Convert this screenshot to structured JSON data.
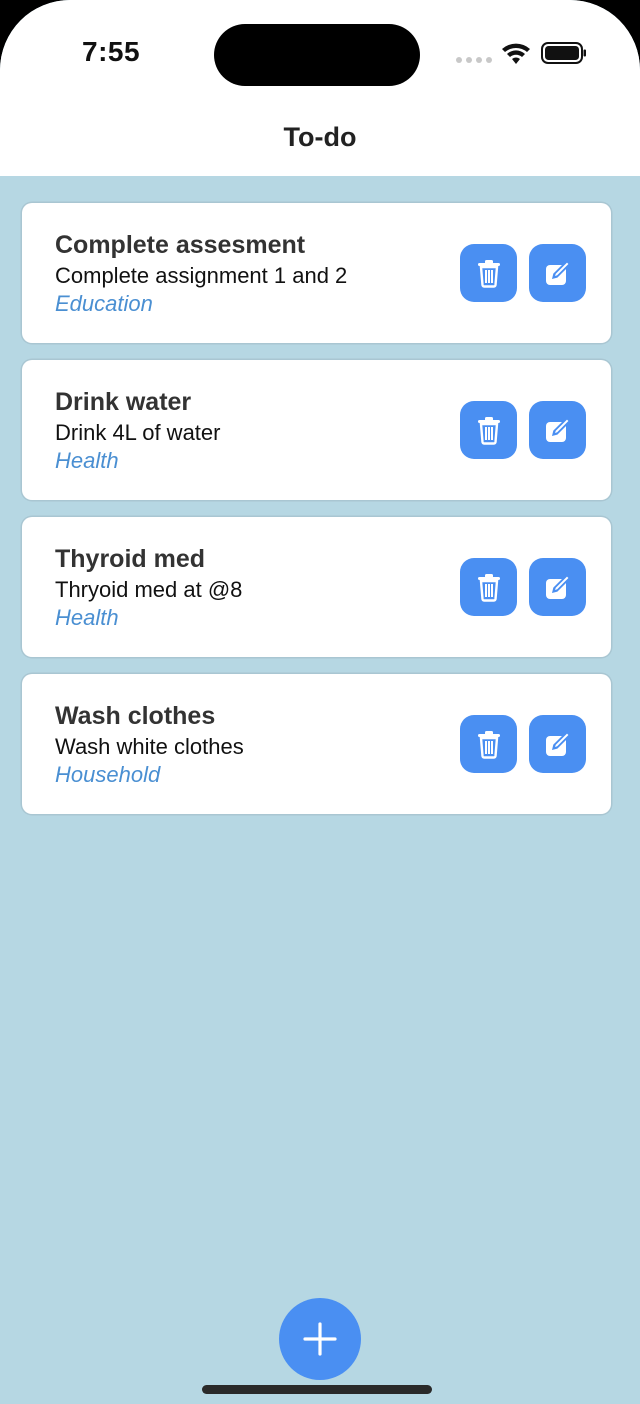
{
  "status_bar": {
    "time": "7:55",
    "icons": [
      "signal-dots-icon",
      "wifi-icon",
      "battery-icon"
    ]
  },
  "header": {
    "title": "To-do"
  },
  "todos": [
    {
      "title": "Complete assesment",
      "description": "Complete assignment 1 and 2",
      "category": "Education"
    },
    {
      "title": "Drink water",
      "description": "Drink 4L of water",
      "category": "Health"
    },
    {
      "title": "Thyroid med",
      "description": "Thryoid med at @8",
      "category": "Health"
    },
    {
      "title": "Wash clothes",
      "description": "Wash white clothes",
      "category": "Household"
    }
  ],
  "actions": {
    "delete_icon": "trash-icon",
    "edit_icon": "edit-icon",
    "add_icon": "plus-icon"
  },
  "colors": {
    "background": "#b6d7e3",
    "accent": "#4a8ff2",
    "category_text": "#4a8fd2",
    "card": "#ffffff"
  }
}
